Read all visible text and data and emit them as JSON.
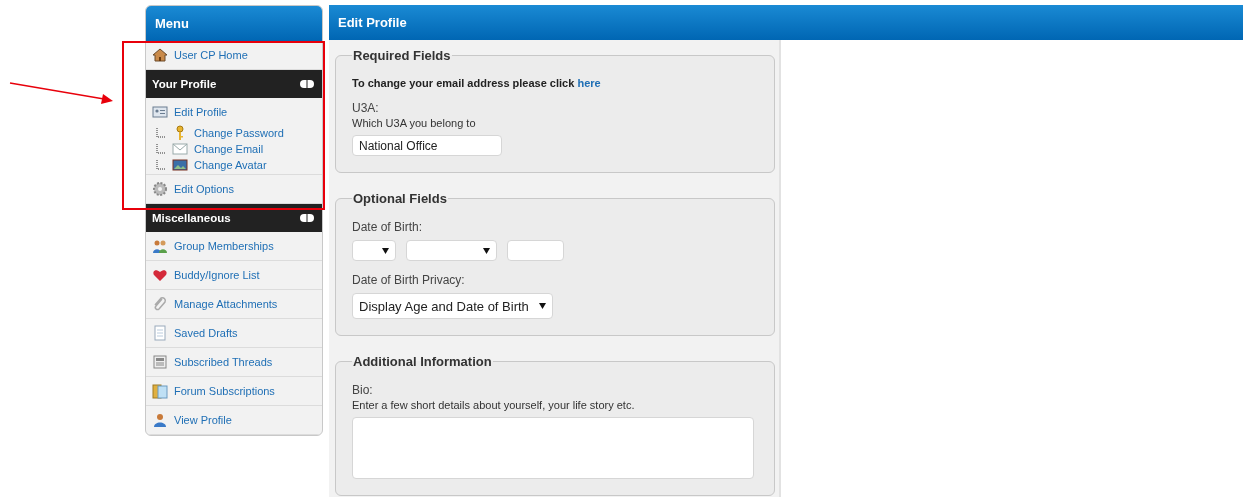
{
  "menu": {
    "title": "Menu",
    "home": {
      "label": "User CP Home"
    },
    "sections": [
      {
        "title": "Your Profile",
        "items": [
          {
            "label": "Edit Profile",
            "children": [
              {
                "label": "Change Password"
              },
              {
                "label": "Change Email"
              },
              {
                "label": "Change Avatar"
              }
            ]
          },
          {
            "label": "Edit Options"
          }
        ]
      },
      {
        "title": "Miscellaneous",
        "items": [
          {
            "label": "Group Memberships"
          },
          {
            "label": "Buddy/Ignore List"
          },
          {
            "label": "Manage Attachments"
          },
          {
            "label": "Saved Drafts"
          },
          {
            "label": "Subscribed Threads"
          },
          {
            "label": "Forum Subscriptions"
          },
          {
            "label": "View Profile"
          }
        ]
      }
    ]
  },
  "panel": {
    "title": "Edit Profile",
    "fieldsets": [
      {
        "legend": "Required Fields",
        "note": "To change your email address please click",
        "note_link": "here",
        "fields": [
          {
            "kind": "text",
            "label": "U3A:",
            "description": "Which U3A you belong to",
            "value": "National Office"
          }
        ]
      },
      {
        "legend": "Optional Fields",
        "fields": [
          {
            "kind": "date",
            "label": "Date of Birth:"
          },
          {
            "kind": "select",
            "label": "Date of Birth Privacy:",
            "value": "Display Age and Date of Birth"
          }
        ]
      },
      {
        "legend": "Additional Information",
        "fields": [
          {
            "kind": "textarea",
            "label": "Bio:",
            "description": "Enter a few short details about yourself, your life story etc."
          }
        ]
      }
    ]
  }
}
